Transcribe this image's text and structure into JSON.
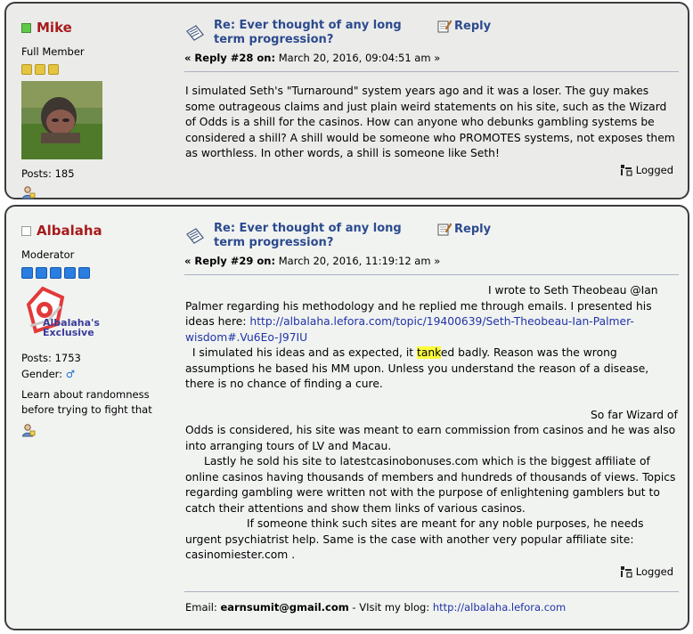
{
  "posts": [
    {
      "username": "Mike",
      "online": true,
      "rank": "Full Member",
      "star_color": "#e4c441",
      "star_count": 3,
      "posts_label": "Posts: 185",
      "subject": "Re: Ever thought of any long term progression?",
      "reply_label": "Reply",
      "reply_no": "« Reply #28 on:",
      "date": " March 20, 2016, 09:04:51 am »",
      "body": [
        "I simulated Seth's \"Turnaround\" system years ago and it was a loser. The guy makes some outrageous claims and just plain weird statements on his site,  such as the Wizard of Odds is a shill for the casinos. How can anyone who debunks gambling systems be considered a shill? A shill would be someone who PROMOTES systems, not exposes them as worthless. In other words, a shill is someone like Seth!"
      ],
      "logged_label": "Logged"
    },
    {
      "username": "Albalaha",
      "online": false,
      "rank": "Moderator",
      "star_color": "#2a7de1",
      "star_count": 5,
      "avatar_text": "Albalaha's Exclusive",
      "posts_label": "Posts: 1753",
      "gender_label": "Gender:",
      "gender_symbol": "♂",
      "personal_text": "Learn about randomness before trying to fight that",
      "subject": "Re: Ever thought of any long term progression?",
      "reply_label": "Reply",
      "reply_no": "« Reply #29 on:",
      "date": " March 20, 2016, 11:19:12 am »",
      "body_p1_pre": "I wrote to Seth Theobeau @Ian Palmer regarding his methodology and he replied me through emails. I presented his ideas here: ",
      "body_link": "http://albalaha.lefora.com/topic/19400639/Seth-Theobeau-Ian-Palmer-wisdom#.Vu6Eo-J97IU",
      "body_p2_pre": "  I simulated his ideas and as expected, it ",
      "body_p2_hl": "tank",
      "body_p2_post": "ed badly. Reason was the wrong assumptions he based his MM upon. Unless you understand the reason of a disease, there is no chance of finding a cure.",
      "body_p3": "So far Wizard of Odds is considered, his site was meant to earn commission from casinos and he was also into arranging tours of LV and Macau.",
      "body_p4": "Lastly he sold his site to latestcasinobonuses.com which is the biggest affiliate of online casinos having thousands of members and hundreds of thousands of views. Topics regarding gambling were written not with the purpose of enlightening gamblers but to catch their attentions and show them links of various casinos.",
      "body_p5": "If someone think such sites are meant for any noble purposes, he needs urgent psychiatrist help. Same is the case with another very popular affiliate site: casinomiester.com .",
      "logged_label": "Logged",
      "sig_email_label": "Email: ",
      "sig_email": "earnsumit@gmail.com",
      "sig_blog_label": " - VIsit my blog: ",
      "sig_blog_link": "http://albalaha.lefora.com"
    }
  ],
  "colors": {
    "username": "#a61c1c",
    "subject_link": "#2c4b8e",
    "body_link": "#2133a8",
    "highlight": "#fcfc3c",
    "post1_bg": "#ebebea",
    "post2_bg": "#f1f3f1"
  }
}
